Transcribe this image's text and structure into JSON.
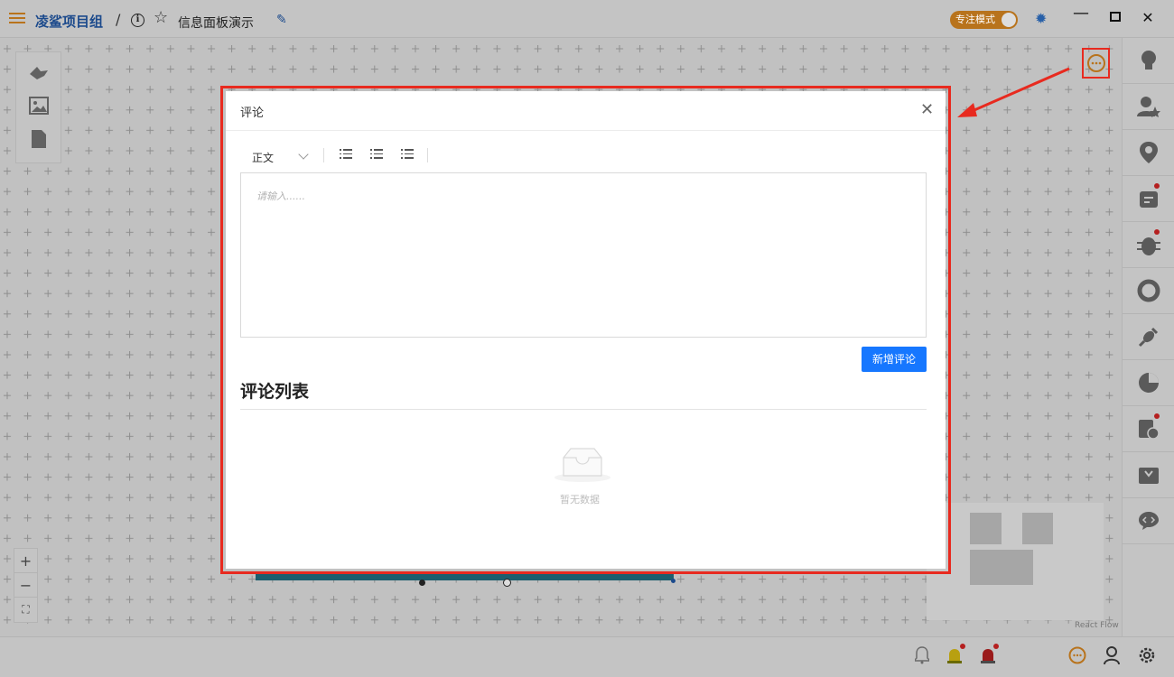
{
  "header": {
    "project_name": "凌鲨项目组",
    "separator": "/",
    "board_name": "信息面板演示",
    "focus_mode_label": "专注模式"
  },
  "modal": {
    "title": "评论",
    "format_select": "正文",
    "editor_placeholder": "请输入......",
    "add_button": "新增评论",
    "list_heading": "评论列表",
    "empty_text": "暂无数据"
  },
  "canvas": {
    "attribution": "React Flow"
  },
  "icons": {
    "left_tools": [
      "shark-icon",
      "image-icon",
      "document-icon"
    ],
    "right_panel": [
      "bulb-icon",
      "user-star-icon",
      "location-icon",
      "card-icon",
      "bug-icon",
      "ring-icon",
      "plug-icon",
      "pie-chart-icon",
      "doc-clock-icon",
      "download-icon",
      "code-chat-icon"
    ],
    "bottom_bar": [
      "bell-icon",
      "alarm-yellow-icon",
      "alarm-red-icon",
      "comment-icon",
      "user-icon",
      "gear-icon"
    ]
  },
  "colors": {
    "accent": "#b8731c",
    "primary_button": "#1677ff",
    "highlight_outline": "#e82a1f",
    "project_text": "#1c4a8c"
  }
}
